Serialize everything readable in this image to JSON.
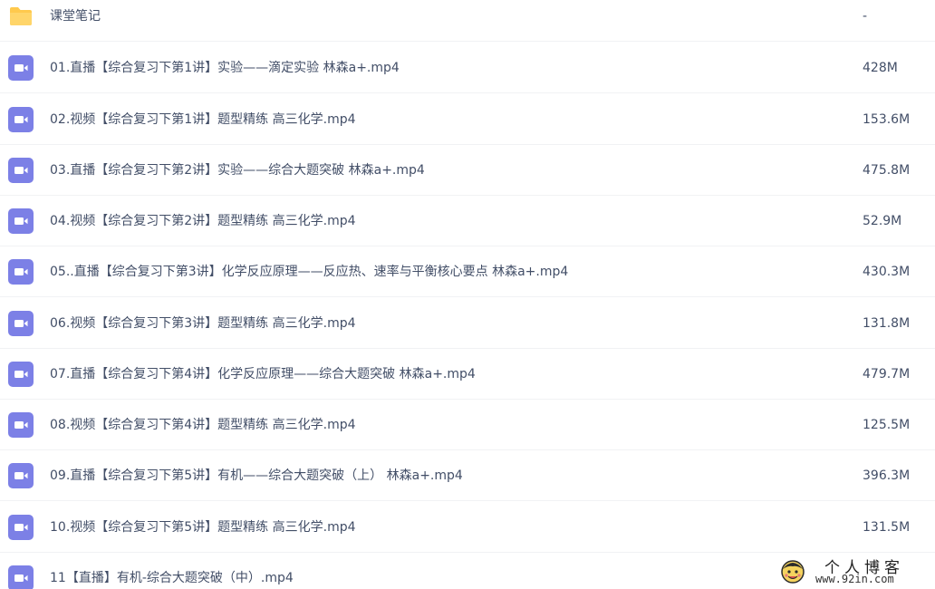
{
  "colors": {
    "folder": "#FFC94D",
    "video_icon": "#7C80E6",
    "text": "#424E67",
    "divider": "#F1F2F4"
  },
  "files": [
    {
      "name": "课堂笔记",
      "size": "-",
      "icon": "folder-icon"
    },
    {
      "name": "01.直播【综合复习下第1讲】实验——滴定实验 林森a+.mp4",
      "size": "428M",
      "icon": "video-file-icon"
    },
    {
      "name": "02.视频【综合复习下第1讲】题型精练 高三化学.mp4",
      "size": "153.6M",
      "icon": "video-file-icon"
    },
    {
      "name": "03.直播【综合复习下第2讲】实验——综合大题突破 林森a+.mp4",
      "size": "475.8M",
      "icon": "video-file-icon"
    },
    {
      "name": "04.视频【综合复习下第2讲】题型精练 高三化学.mp4",
      "size": "52.9M",
      "icon": "video-file-icon"
    },
    {
      "name": "05..直播【综合复习下第3讲】化学反应原理——反应热、速率与平衡核心要点 林森a+.mp4",
      "size": "430.3M",
      "icon": "video-file-icon"
    },
    {
      "name": "06.视频【综合复习下第3讲】题型精练 高三化学.mp4",
      "size": "131.8M",
      "icon": "video-file-icon"
    },
    {
      "name": "07.直播【综合复习下第4讲】化学反应原理——综合大题突破 林森a+.mp4",
      "size": "479.7M",
      "icon": "video-file-icon"
    },
    {
      "name": "08.视频【综合复习下第4讲】题型精练 高三化学.mp4",
      "size": "125.5M",
      "icon": "video-file-icon"
    },
    {
      "name": "09.直播【综合复习下第5讲】有机——综合大题突破（上） 林森a+.mp4",
      "size": "396.3M",
      "icon": "video-file-icon"
    },
    {
      "name": "10.视频【综合复习下第5讲】题型精练 高三化学.mp4",
      "size": "131.5M",
      "icon": "video-file-icon"
    },
    {
      "name": "11【直播】有机-综合大题突破（中）.mp4",
      "size": "",
      "icon": "video-file-icon"
    }
  ],
  "watermark": {
    "title": "个人博客",
    "url": "www.92in.com",
    "icon": "cartoon-face-icon"
  }
}
